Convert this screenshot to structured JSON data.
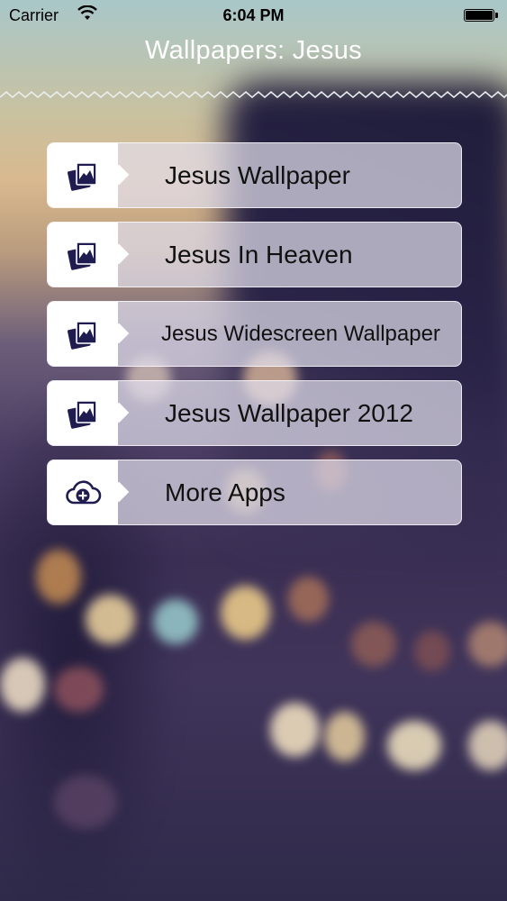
{
  "status_bar": {
    "carrier": "Carrier",
    "time": "6:04 PM"
  },
  "nav": {
    "title": "Wallpapers: Jesus"
  },
  "menu": {
    "items": [
      {
        "label": "Jesus Wallpaper",
        "icon": "photos-icon"
      },
      {
        "label": "Jesus In Heaven",
        "icon": "photos-icon"
      },
      {
        "label": "Jesus Widescreen Wallpaper",
        "icon": "photos-icon"
      },
      {
        "label": "Jesus Wallpaper 2012",
        "icon": "photos-icon"
      },
      {
        "label": "More Apps",
        "icon": "cloud-add-icon"
      }
    ]
  },
  "colors": {
    "icon": "#1f1d4f",
    "menu_background": "#e1deec",
    "title": "#ffffff"
  }
}
